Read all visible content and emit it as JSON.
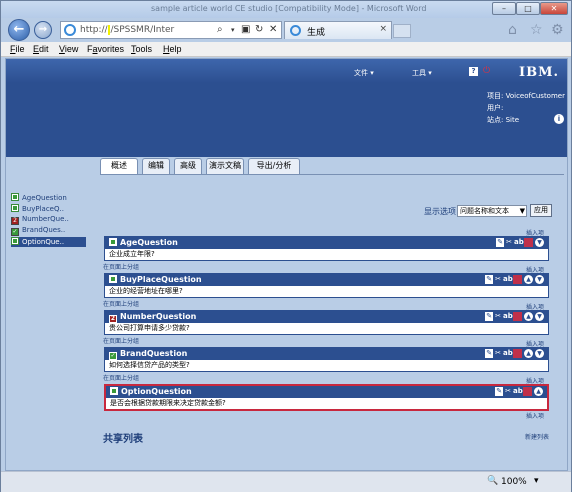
{
  "browser": {
    "window_title": "sample article world CE studio [Compatibility Mode] - Microsoft Word",
    "url": "http://",
    "url_redacted": "               ",
    "url_rest": "/SPSSMR/Inter",
    "tab_title": "生成",
    "zoom": "100%",
    "back_label": "←",
    "forward_label": "→",
    "close_tab": "×"
  },
  "menu": {
    "file": {
      "acc": "F",
      "rest": "ile"
    },
    "edit": {
      "acc": "E",
      "rest": "dit"
    },
    "view": {
      "acc": "V",
      "rest": "iew"
    },
    "favorites": {
      "pre": "F",
      "acc": "a",
      "rest": "vorites"
    },
    "tools": {
      "acc": "T",
      "rest": "ools"
    },
    "help": {
      "acc": "H",
      "rest": "elp"
    }
  },
  "app_header": {
    "file_menu": "文件 ▾",
    "tools_menu": "工具 ▾",
    "help_icon": "?",
    "brand": "IBM.",
    "project_label": "项目: ",
    "project_value": "VoiceofCustomer",
    "user_label": "用户: ",
    "user_value": "              ",
    "site_label": "站点: ",
    "site_value": "Site",
    "info_icon": "i"
  },
  "tabs": [
    "概述",
    "编辑",
    "高级",
    "演示文稿",
    "导出/分析"
  ],
  "sidebar": [
    {
      "label": "AgeQuestion",
      "badge": "",
      "type": "single",
      "selected": false
    },
    {
      "label": "BuyPlaceQ..",
      "badge": "",
      "type": "single",
      "selected": false
    },
    {
      "label": "NumberQue..",
      "badge": "2",
      "type": "num",
      "selected": false
    },
    {
      "label": "BrandQues..",
      "badge": "✓",
      "type": "check",
      "selected": false
    },
    {
      "label": "OptionQue..",
      "badge": "",
      "type": "single",
      "selected": true
    }
  ],
  "display_options": {
    "label": "显示选项",
    "selected": "问题名称和文本",
    "apply": "应用"
  },
  "insert_item": "插入项",
  "insert_above": "在页面上分组",
  "questions": [
    {
      "name": "AgeQuestion",
      "text": "企业成立年限?",
      "type": "single",
      "badge": ""
    },
    {
      "name": "BuyPlaceQuestion",
      "text": "企业的经营地址在哪里?",
      "type": "single",
      "badge": ""
    },
    {
      "name": "NumberQuestion",
      "text": "贵公司打算申请多少贷款?",
      "type": "num",
      "badge": "2"
    },
    {
      "name": "BrandQuestion",
      "text": "如何选择信贷产品的类型?",
      "type": "check",
      "badge": "✓"
    },
    {
      "name": "OptionQuestion",
      "text": "是否会根据贷款期限来决定贷款金额?",
      "type": "single",
      "badge": ""
    }
  ],
  "shared_list": {
    "title": "共享列表",
    "new_list": "新建列表"
  }
}
